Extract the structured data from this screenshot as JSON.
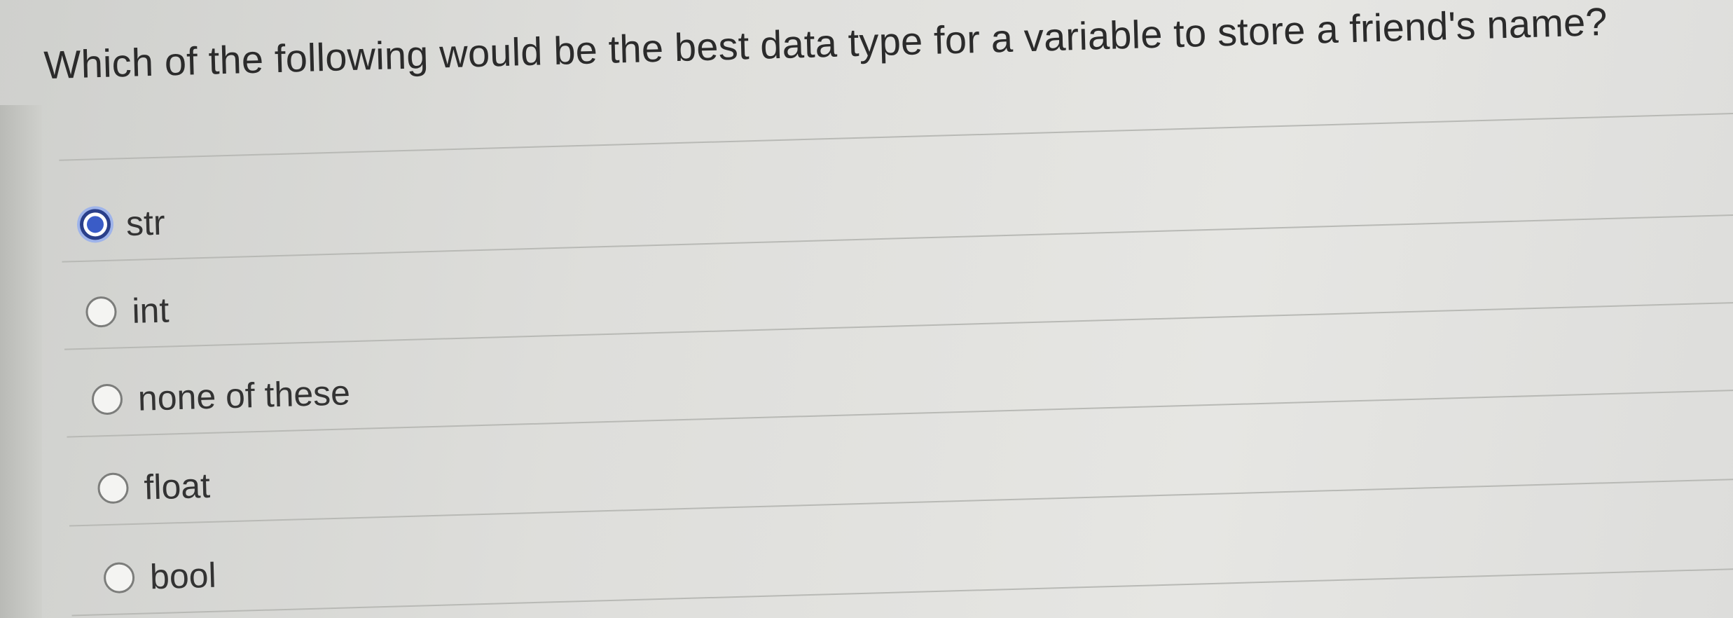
{
  "question": {
    "text": "Which of the following would be the best data type for a variable to store a friend's name?"
  },
  "options": [
    {
      "label": "str",
      "selected": true
    },
    {
      "label": "int",
      "selected": false
    },
    {
      "label": "none of these",
      "selected": false
    },
    {
      "label": "float",
      "selected": false
    },
    {
      "label": "bool",
      "selected": false
    }
  ],
  "colors": {
    "selected_radio": "#3a5cc7",
    "text": "#333333"
  }
}
